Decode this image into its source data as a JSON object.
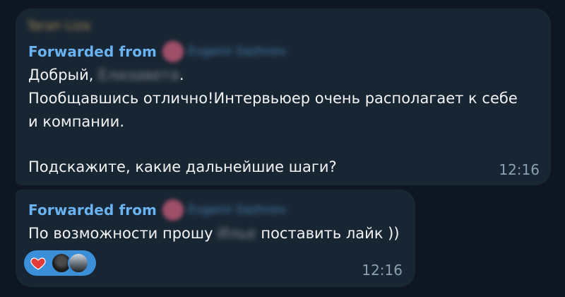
{
  "messages": [
    {
      "sender": "Taran Liza",
      "forwarded_label": "Forwarded from",
      "forwarded_name": "Evgenii Sazhnev",
      "line1_prefix": "Добрый, ",
      "line1_blurred": "Елизавета",
      "line1_suffix": ".",
      "line2": "Пообщавшись отлично!Интервьюер очень располагает к себе",
      "line3": "и компании.",
      "line4": "Подскажите, какие дальнейшие шаги?",
      "time": "12:16"
    },
    {
      "forwarded_label": "Forwarded from",
      "forwarded_name": "Evgenii Sazhnev",
      "line1_prefix": "По возможности прошу ",
      "line1_blurred": "Илье",
      "line1_suffix": " поставить лайк ))",
      "time": "12:16",
      "reaction": {
        "emoji": "heart-icon",
        "accent_color": "#3b8fd9"
      }
    }
  ],
  "colors": {
    "background": "#0e1621",
    "bubble": "#182533",
    "link": "#6ab3f3",
    "time": "#8ba0b2",
    "heart": "#e53935"
  }
}
